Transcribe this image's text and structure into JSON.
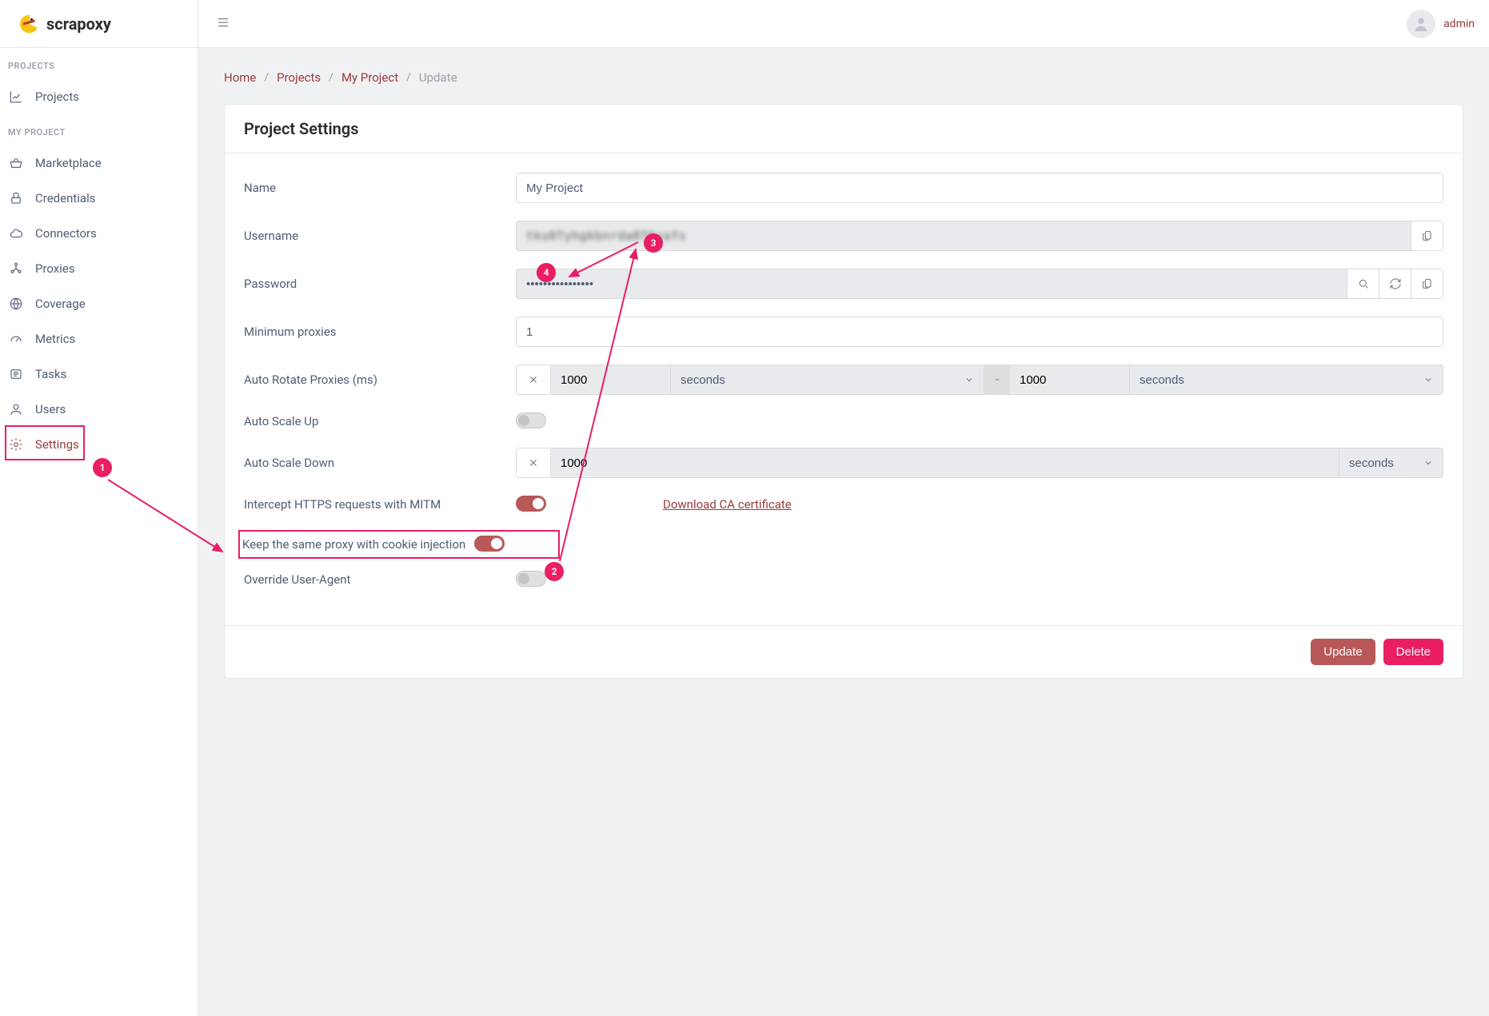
{
  "brand": {
    "name": "scrapoxy"
  },
  "user": {
    "name": "admin"
  },
  "sidebar": {
    "sections": {
      "projects_title": "PROJECTS",
      "myproject_title": "MY PROJECT"
    },
    "items": {
      "projects": "Projects",
      "marketplace": "Marketplace",
      "credentials": "Credentials",
      "connectors": "Connectors",
      "proxies": "Proxies",
      "coverage": "Coverage",
      "metrics": "Metrics",
      "tasks": "Tasks",
      "users": "Users",
      "settings": "Settings"
    }
  },
  "breadcrumb": {
    "home": "Home",
    "projects": "Projects",
    "project": "My Project",
    "current": "Update"
  },
  "card": {
    "title": "Project Settings"
  },
  "form": {
    "labels": {
      "name": "Name",
      "username": "Username",
      "password": "Password",
      "min_proxies": "Minimum proxies",
      "auto_rotate": "Auto Rotate Proxies (ms)",
      "auto_scale_up": "Auto Scale Up",
      "auto_scale_down": "Auto Scale Down",
      "mitm": "Intercept HTTPS requests with MITM",
      "cookie_injection": "Keep the same proxy with cookie injection",
      "override_ua": "Override User-Agent"
    },
    "values": {
      "name": "My Project",
      "username": "tku0Tyhgkbnrda8T6xafs",
      "password": "••••••••••••••••",
      "min_proxies": "1",
      "auto_rotate_min": "1000",
      "auto_rotate_max": "1000",
      "auto_rotate_unit_min": "seconds",
      "auto_rotate_unit_max": "seconds",
      "auto_scale_down_val": "1000",
      "auto_scale_down_unit": "seconds",
      "range_sep": "-"
    },
    "link_download": "Download CA certificate"
  },
  "buttons": {
    "update": "Update",
    "delete": "Delete"
  },
  "callouts": {
    "c1": "1",
    "c2": "2",
    "c3": "3",
    "c4": "4"
  }
}
